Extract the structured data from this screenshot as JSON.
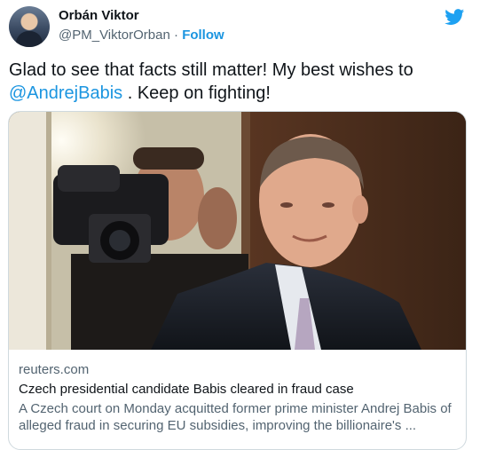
{
  "header": {
    "display_name": "Orbán Viktor",
    "handle": "@PM_ViktorOrban",
    "separator": "·",
    "follow_label": "Follow"
  },
  "icons": {
    "avatar": "profile-photo",
    "bird": "twitter-bird-icon"
  },
  "colors": {
    "accent": "#1b95e0",
    "text": "#0f1419",
    "muted": "#536471",
    "border": "#cfd9de"
  },
  "tweet": {
    "text_before": "Glad to see that facts still matter! My best wishes to ",
    "mention": "@AndrejBabis",
    "text_after": " . Keep on fighting!"
  },
  "card": {
    "domain": "reuters.com",
    "title": "Czech presidential candidate Babis cleared in fraud case",
    "description": "A Czech court on Monday acquitted former prime minister Andrej Babis of alleged fraud in securing EU subsidies, improving the billionaire's ..."
  }
}
